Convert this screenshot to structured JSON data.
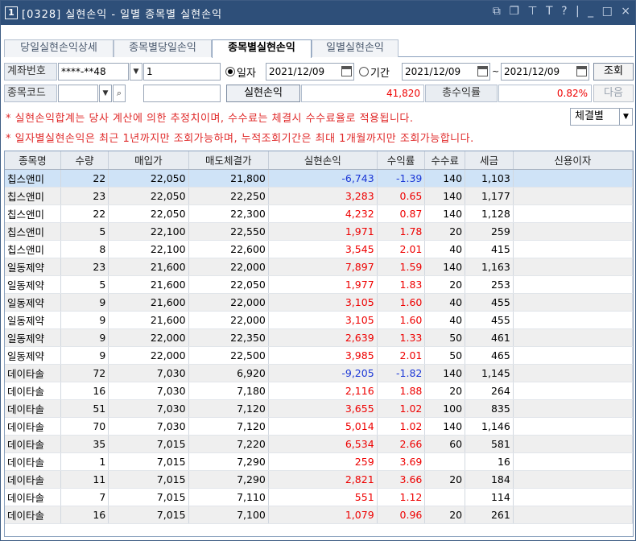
{
  "window": {
    "number": "1",
    "title": "[0328] 실현손익 - 일별 종목별 실현손익"
  },
  "tabs": [
    "당일실현손익상세",
    "종목별당일손익",
    "종목별실현손익",
    "일별실현손익"
  ],
  "form": {
    "account_label": "계좌번호",
    "account_value": "****-**48",
    "account_sub": "1",
    "date_radio": "일자",
    "date_value": "2021/12/09",
    "period_radio": "기간",
    "period_from": "2021/12/09",
    "period_to": "2021/12/09",
    "tilde": "~",
    "query_btn": "조회",
    "code_label": "종목코드",
    "realized_label": "실현손익",
    "realized_value": "41,820",
    "total_rate_label": "총수익률",
    "total_rate_value": "0.82%",
    "next_btn": "다음"
  },
  "notices": [
    "* 실현손익합계는 당사 계산에 의한 추정치이며, 수수료는 체결시 수수료율로 적용됩니다.",
    "* 일자별실현손익은 최근 1년까지만 조회가능하며, 누적조회기간은 최대 1개월까지만 조회가능합니다."
  ],
  "sort_select": "체결별",
  "table": {
    "headers": [
      "종목명",
      "수량",
      "매입가",
      "매도체결가",
      "실현손익",
      "수익률",
      "수수료",
      "세금",
      "신용이자"
    ],
    "rows": [
      [
        "칩스앤미",
        "22",
        "22,050",
        "21,800",
        "-6,743",
        "-1.39",
        "140",
        "1,103",
        ""
      ],
      [
        "칩스앤미",
        "23",
        "22,050",
        "22,250",
        "3,283",
        "0.65",
        "140",
        "1,177",
        ""
      ],
      [
        "칩스앤미",
        "22",
        "22,050",
        "22,300",
        "4,232",
        "0.87",
        "140",
        "1,128",
        ""
      ],
      [
        "칩스앤미",
        "5",
        "22,100",
        "22,550",
        "1,971",
        "1.78",
        "20",
        "259",
        ""
      ],
      [
        "칩스앤미",
        "8",
        "22,100",
        "22,600",
        "3,545",
        "2.01",
        "40",
        "415",
        ""
      ],
      [
        "일동제약",
        "23",
        "21,600",
        "22,000",
        "7,897",
        "1.59",
        "140",
        "1,163",
        ""
      ],
      [
        "일동제약",
        "5",
        "21,600",
        "22,050",
        "1,977",
        "1.83",
        "20",
        "253",
        ""
      ],
      [
        "일동제약",
        "9",
        "21,600",
        "22,000",
        "3,105",
        "1.60",
        "40",
        "455",
        ""
      ],
      [
        "일동제약",
        "9",
        "21,600",
        "22,000",
        "3,105",
        "1.60",
        "40",
        "455",
        ""
      ],
      [
        "일동제약",
        "9",
        "22,000",
        "22,350",
        "2,639",
        "1.33",
        "50",
        "461",
        ""
      ],
      [
        "일동제약",
        "9",
        "22,000",
        "22,500",
        "3,985",
        "2.01",
        "50",
        "465",
        ""
      ],
      [
        "데이타솔",
        "72",
        "7,030",
        "6,920",
        "-9,205",
        "-1.82",
        "140",
        "1,145",
        ""
      ],
      [
        "데이타솔",
        "16",
        "7,030",
        "7,180",
        "2,116",
        "1.88",
        "20",
        "264",
        ""
      ],
      [
        "데이타솔",
        "51",
        "7,030",
        "7,120",
        "3,655",
        "1.02",
        "100",
        "835",
        ""
      ],
      [
        "데이타솔",
        "70",
        "7,030",
        "7,120",
        "5,014",
        "1.02",
        "140",
        "1,146",
        ""
      ],
      [
        "데이타솔",
        "35",
        "7,015",
        "7,220",
        "6,534",
        "2.66",
        "60",
        "581",
        ""
      ],
      [
        "데이타솔",
        "1",
        "7,015",
        "7,290",
        "259",
        "3.69",
        "",
        "16",
        ""
      ],
      [
        "데이타솔",
        "11",
        "7,015",
        "7,290",
        "2,821",
        "3.66",
        "20",
        "184",
        ""
      ],
      [
        "데이타솔",
        "7",
        "7,015",
        "7,110",
        "551",
        "1.12",
        "",
        "114",
        ""
      ],
      [
        "데이타솔",
        "16",
        "7,015",
        "7,100",
        "1,079",
        "0.96",
        "20",
        "261",
        ""
      ]
    ]
  },
  "colors": {
    "titlebar": "#2e4f79",
    "negative": "#1b37d6",
    "positive": "#e00000",
    "selected_row": "#cfe3f7"
  }
}
